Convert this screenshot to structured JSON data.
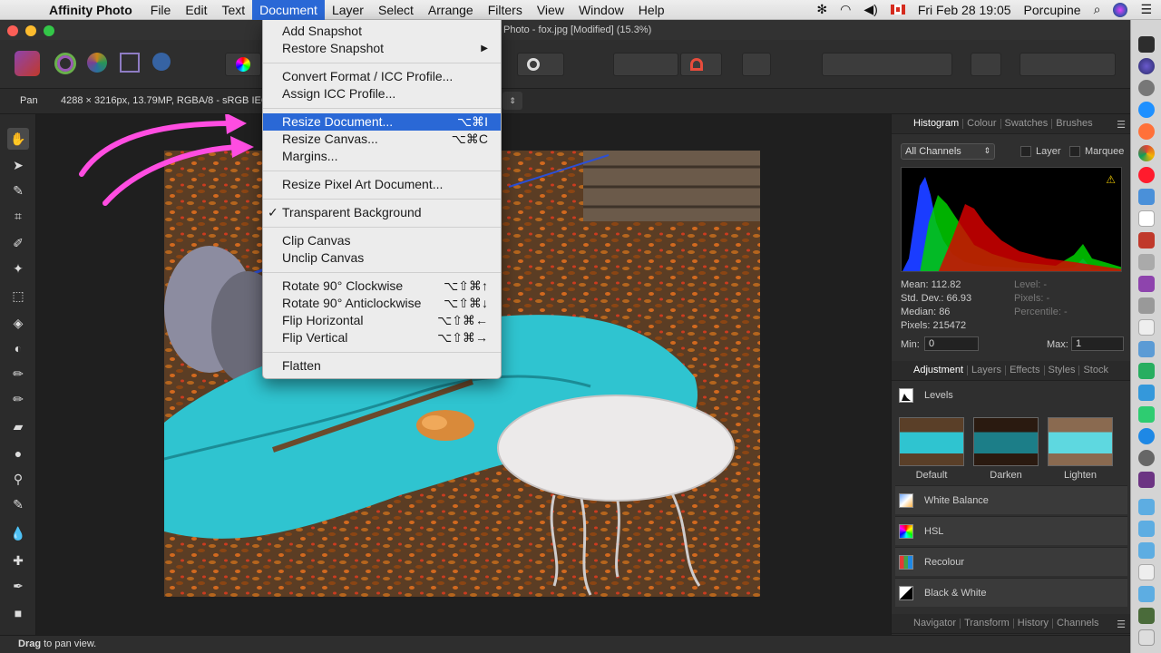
{
  "menubar": {
    "app_name": "Affinity Photo",
    "items": [
      "File",
      "Edit",
      "Text",
      "Document",
      "Layer",
      "Select",
      "Arrange",
      "Filters",
      "View",
      "Window",
      "Help"
    ],
    "clock": "Fri Feb 28  19:05",
    "user": "Porcupine"
  },
  "window": {
    "title": "Photo - fox.jpg [Modified] (15.3%)"
  },
  "context": {
    "tool_name": "Pan",
    "doc_info": "4288 × 3216px, 13.79MP, RGBA/8 - sRGB IEC"
  },
  "status": {
    "bold": "Drag",
    "text": "to pan view."
  },
  "document_menu": {
    "items": [
      {
        "label": "Add Snapshot",
        "shortcut": ""
      },
      {
        "label": "Restore Snapshot",
        "shortcut": "▶"
      },
      {
        "label": "Convert Format / ICC Profile...",
        "shortcut": ""
      },
      {
        "label": "Assign ICC Profile...",
        "shortcut": ""
      },
      {
        "label": "Resize Document...",
        "shortcut": "⌥⌘I"
      },
      {
        "label": "Resize Canvas...",
        "shortcut": "⌥⌘C"
      },
      {
        "label": "Margins...",
        "shortcut": ""
      },
      {
        "label": "Resize Pixel Art Document...",
        "shortcut": ""
      },
      {
        "label": "Transparent Background",
        "shortcut": "",
        "check": "✓"
      },
      {
        "label": "Clip Canvas",
        "shortcut": ""
      },
      {
        "label": "Unclip Canvas",
        "shortcut": ""
      },
      {
        "label": "Rotate 90° Clockwise",
        "shortcut": "⌥⇧⌘↑"
      },
      {
        "label": "Rotate 90° Anticlockwise",
        "shortcut": "⌥⇧⌘↓"
      },
      {
        "label": "Flip Horizontal",
        "shortcut": "⌥⇧⌘←"
      },
      {
        "label": "Flip Vertical",
        "shortcut": "⌥⇧⌘→"
      },
      {
        "label": "Flatten",
        "shortcut": ""
      }
    ]
  },
  "histogram_panel": {
    "tabs": [
      "Histogram",
      "Colour",
      "Swatches",
      "Brushes"
    ],
    "channel_select": "All Channels",
    "layer_label": "Layer",
    "marquee_label": "Marquee",
    "warning": "⚠",
    "stats_left": [
      "Mean: 112.82",
      "Std. Dev.: 66.93",
      "Median: 86",
      "Pixels: 215472"
    ],
    "stats_right": [
      "Level: -",
      "Pixels: -",
      "Percentile: -"
    ],
    "min_label": "Min:",
    "min_value": "0",
    "max_label": "Max:",
    "max_value": "1"
  },
  "adjustment_panel": {
    "tabs": [
      "Adjustment",
      "Layers",
      "Effects",
      "Styles",
      "Stock"
    ],
    "levels_label": "Levels",
    "presets": [
      "Default",
      "Darken",
      "Lighten"
    ],
    "rows": [
      "White Balance",
      "HSL",
      "Recolour",
      "Black & White"
    ]
  },
  "bottom_tabs": [
    "Navigator",
    "Transform",
    "History",
    "Channels"
  ],
  "colors": {
    "menu_highlight": "#2a68d6",
    "annotation_arrow": "#ff4de1",
    "tarp": "#2fc4d0"
  }
}
